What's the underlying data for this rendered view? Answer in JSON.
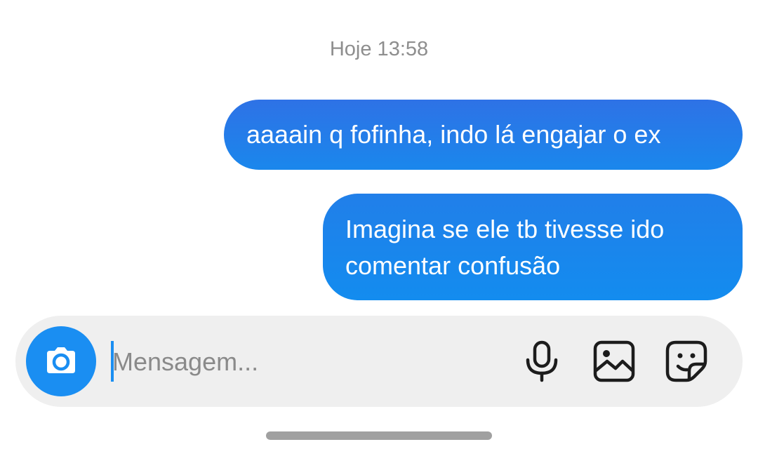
{
  "chat": {
    "timestamp": "Hoje 13:58",
    "messages": [
      {
        "sender": "me",
        "text": "aaaain q fofinha, indo lá engajar o ex"
      },
      {
        "sender": "me",
        "text": "Imagina se ele tb tivesse ido comentar confusão"
      }
    ]
  },
  "composer": {
    "placeholder": "Mensagem...",
    "value": "",
    "icons": {
      "camera": "camera-icon",
      "microphone": "microphone-icon",
      "gallery": "gallery-icon",
      "sticker": "sticker-icon"
    }
  },
  "colors": {
    "bubble_top": "#2e72e6",
    "bubble_bottom": "#138cef",
    "camera_button": "#1a8ef2",
    "composer_bg": "#efefef",
    "timestamp_text": "#8e8e8e"
  }
}
